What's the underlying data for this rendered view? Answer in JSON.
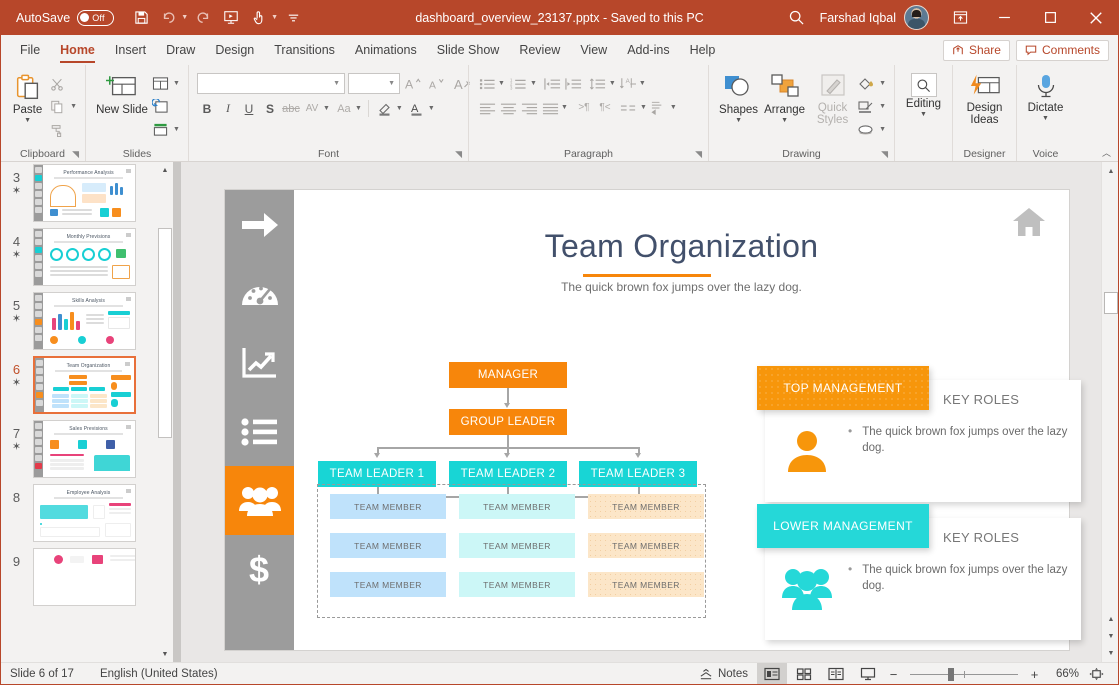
{
  "titlebar": {
    "autosave_label": "AutoSave",
    "autosave_state": "Off",
    "doc_title": "dashboard_overview_23137.pptx  -  Saved to this PC",
    "user_name": "Farshad Iqbal",
    "qat": [
      {
        "name": "save-icon",
        "label": "Save"
      },
      {
        "name": "undo-icon",
        "label": "Undo"
      },
      {
        "name": "redo-icon",
        "label": "Redo"
      },
      {
        "name": "start-presentation-icon",
        "label": "Start From Beginning"
      },
      {
        "name": "touch-mode-icon",
        "label": "Touch/Mouse Mode"
      },
      {
        "name": "customize-quick-access-icon",
        "label": "Customize Quick Access Toolbar"
      }
    ],
    "search_tooltip": "Search",
    "window": {
      "minimize": "Minimize",
      "restore": "Restore",
      "close": "Close",
      "ribbon_display": "Ribbon Display Options"
    }
  },
  "tabs": [
    {
      "label": "File",
      "active": false
    },
    {
      "label": "Home",
      "active": true
    },
    {
      "label": "Insert",
      "active": false
    },
    {
      "label": "Draw",
      "active": false
    },
    {
      "label": "Design",
      "active": false
    },
    {
      "label": "Transitions",
      "active": false
    },
    {
      "label": "Animations",
      "active": false
    },
    {
      "label": "Slide Show",
      "active": false
    },
    {
      "label": "Review",
      "active": false
    },
    {
      "label": "View",
      "active": false
    },
    {
      "label": "Add-ins",
      "active": false
    },
    {
      "label": "Help",
      "active": false
    }
  ],
  "tab_actions": {
    "share_label": "Share",
    "comments_label": "Comments"
  },
  "ribbon": {
    "groups": [
      {
        "label": "Clipboard",
        "has_dialog_launcher": true
      },
      {
        "label": "Slides",
        "has_dialog_launcher": false
      },
      {
        "label": "Font",
        "has_dialog_launcher": true
      },
      {
        "label": "Paragraph",
        "has_dialog_launcher": true
      },
      {
        "label": "Drawing",
        "has_dialog_launcher": true
      },
      {
        "label": "Designer",
        "has_dialog_launcher": false
      },
      {
        "label": "Voice",
        "has_dialog_launcher": false
      }
    ],
    "clipboard": {
      "paste_label": "Paste",
      "cut": "Cut",
      "copy": "Copy",
      "format_painter": "Format Painter"
    },
    "slides": {
      "new_slide_label": "New Slide",
      "layout": "Layout",
      "reset": "Reset",
      "section": "Section"
    },
    "font": {
      "font_name_value": "",
      "font_name_placeholder": "",
      "font_size_value": "",
      "font_size_placeholder": "",
      "increase_size": "Increase Font Size",
      "decrease_size": "Decrease Font Size",
      "clear_formatting": "Clear All Formatting",
      "bold": "B",
      "italic": "I",
      "underline": "U",
      "shadow": "S",
      "strikethrough": "abc",
      "char_spacing": "AV",
      "change_case": "Aa",
      "highlight": "Text Highlight Color",
      "font_color": "A"
    },
    "paragraph": {
      "bullets": "Bullets",
      "numbering": "Numbering",
      "decrease_indent": "Decrease Indent",
      "increase_indent": "Increase Indent",
      "line_spacing": "Line Spacing",
      "text_direction": "Text Direction",
      "align_left": "Align Left",
      "center": "Center",
      "align_right": "Align Right",
      "justify": "Justify",
      "columns": "Columns",
      "ltr": "Left-to-Right",
      "rtl": "Right-to-Left",
      "align_text": "Align Text",
      "convert_smartart": "Convert to SmartArt"
    },
    "drawing": {
      "shapes_label": "Shapes",
      "arrange_label": "Arrange",
      "quick_styles_label": "Quick Styles",
      "shape_fill": "Shape Fill",
      "shape_outline": "Shape Outline",
      "shape_effects": "Shape Effects"
    },
    "editing": {
      "label": "Editing"
    },
    "designer": {
      "label": "Design Ideas"
    },
    "voice": {
      "label": "Dictate"
    },
    "collapse_ribbon": "Collapse the Ribbon"
  },
  "thumbnails": [
    {
      "number": "3",
      "starred": true,
      "title": "Performance Analysis",
      "current": false,
      "accent": "#18cfd4",
      "accent_index": 1
    },
    {
      "number": "4",
      "starred": true,
      "title": "Monthly Previsions",
      "current": false,
      "accent": "#18cfd4",
      "accent_index": 2
    },
    {
      "number": "5",
      "starred": true,
      "title": "Skills Analysis",
      "current": false,
      "accent": "#f78e1e",
      "accent_index": 3
    },
    {
      "number": "6",
      "starred": true,
      "title": "Team Organization",
      "current": true,
      "accent": "#f78e1e",
      "accent_index": 4
    },
    {
      "number": "7",
      "starred": true,
      "title": "Sales Previsions",
      "current": false,
      "accent": "#e23b4b",
      "accent_index": 5
    },
    {
      "number": "8",
      "starred": false,
      "title": "Employee Analysis",
      "current": false,
      "accent": "#18cfd4",
      "accent_index": 0
    },
    {
      "number": "9",
      "starred": false,
      "title": "",
      "current": false,
      "accent": "#e23b4b",
      "accent_index": 0
    }
  ],
  "slide": {
    "title": "Team Organization",
    "subtitle": "The quick brown fox jumps over the lazy dog.",
    "home_icon": "home-icon",
    "sidebar_icons": [
      {
        "name": "arrow-right-icon",
        "active": false
      },
      {
        "name": "gauge-icon",
        "active": false
      },
      {
        "name": "chart-line-icon",
        "active": false
      },
      {
        "name": "bullet-list-icon",
        "active": false
      },
      {
        "name": "people-group-icon",
        "active": true
      },
      {
        "name": "dollar-icon",
        "active": false
      }
    ],
    "org_chart": {
      "manager": "MANAGER",
      "group_leader": "GROUP LEADER",
      "team_leaders": [
        "TEAM LEADER 1",
        "TEAM LEADER 2",
        "TEAM LEADER 3"
      ],
      "member_label": "TEAM MEMBER",
      "member_columns": [
        {
          "color_key": "blue",
          "rows": [
            "TEAM MEMBER",
            "TEAM MEMBER",
            "TEAM MEMBER"
          ]
        },
        {
          "color_key": "cyan",
          "rows": [
            "TEAM MEMBER",
            "TEAM MEMBER",
            "TEAM MEMBER"
          ]
        },
        {
          "color_key": "peach",
          "rows": [
            "TEAM MEMBER",
            "TEAM MEMBER",
            "TEAM MEMBER"
          ]
        }
      ]
    },
    "cards": [
      {
        "tab_label": "TOP MANAGEMENT",
        "heading": "KEY ROLES",
        "bullet": "The quick brown fox jumps over the lazy dog.",
        "icon": "single-person-icon",
        "color": "#f7960b"
      },
      {
        "tab_label": "LOWER MANAGEMENT",
        "heading": "KEY ROLES",
        "bullet": "The quick brown fox jumps over the lazy dog.",
        "icon": "people-group-icon",
        "color": "#25d8d8"
      }
    ],
    "colors": {
      "title": "#42506b",
      "rule": "#f7860b",
      "orange": "#f7860b",
      "cyan": "#18d5d5",
      "member_blue": "#bfe2fb",
      "member_cyan": "#ccf7f7",
      "member_peach": "#fce6c8",
      "sidebar": "#9c9c9c"
    }
  },
  "status": {
    "slide_counter": "Slide 6 of 17",
    "language": "English (United States)",
    "notes_label": "Notes",
    "views": [
      {
        "name": "normal-view-button",
        "active": true
      },
      {
        "name": "slide-sorter-view-button",
        "active": false
      },
      {
        "name": "reading-view-button",
        "active": false
      },
      {
        "name": "slide-show-button",
        "active": false
      }
    ],
    "zoom_out": "−",
    "zoom_in": "+",
    "zoom_level": "66%",
    "fit_label": "Fit slide to current window"
  }
}
